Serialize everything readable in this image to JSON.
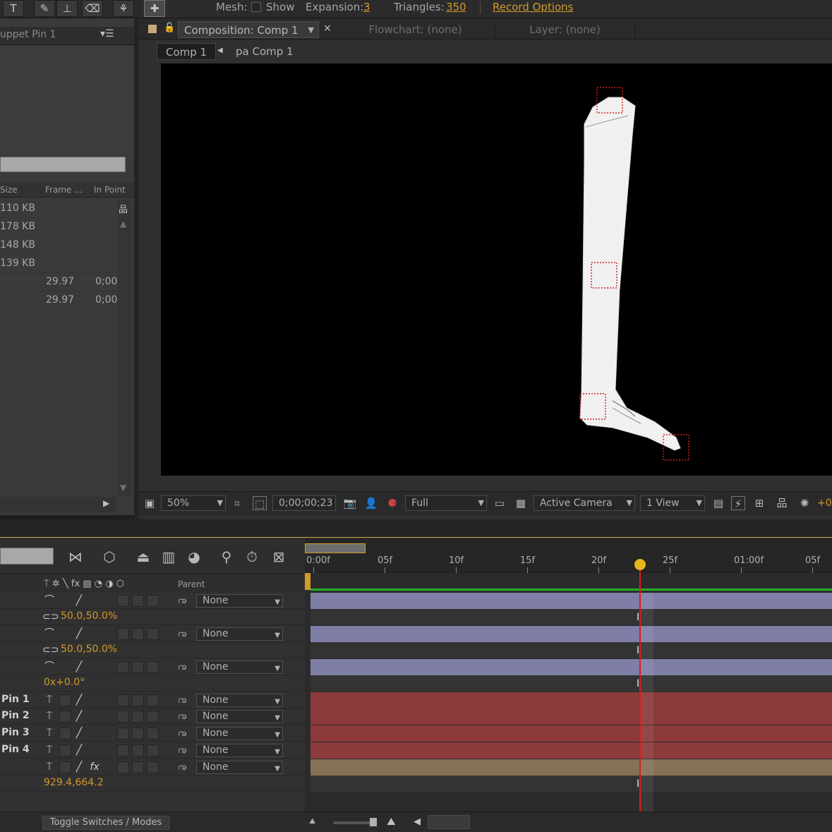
{
  "toolbar": {
    "text_tool": "T",
    "mesh_label": "Mesh:",
    "show_label": "Show",
    "show_checked": false,
    "expansion_label": "Expansion:",
    "expansion_value": "3",
    "triangles_label": "Triangles:",
    "triangles_value": "350",
    "record_options": "Record Options"
  },
  "project_panel": {
    "tab_title": "uppet Pin 1",
    "columns": [
      "Size",
      "Frame ...",
      "In Point"
    ],
    "rows": [
      {
        "size": "110 KB",
        "frame_rate": "",
        "in_point": ""
      },
      {
        "size": "178 KB",
        "frame_rate": "",
        "in_point": ""
      },
      {
        "size": "148 KB",
        "frame_rate": "",
        "in_point": ""
      },
      {
        "size": "139 KB",
        "frame_rate": "",
        "in_point": ""
      },
      {
        "size": "",
        "frame_rate": "29.97",
        "in_point": "0;00"
      },
      {
        "size": "",
        "frame_rate": "29.97",
        "in_point": "0;00"
      }
    ]
  },
  "composition_panel": {
    "tabs": {
      "composition": "Composition: Comp 1",
      "flowchart": "Flowchart: (none)",
      "layer": "Layer: (none)"
    },
    "breadcrumbs": [
      "Comp 1",
      "pa Comp 1"
    ],
    "viewer_bar": {
      "zoom": "50%",
      "timecode": "0;00;00;23",
      "resolution": "Full",
      "camera": "Active Camera",
      "views": "1 View",
      "exposure": "+0"
    }
  },
  "timeline": {
    "columns": {
      "parent": "Parent"
    },
    "ruler_ticks": [
      "0:00f",
      "05f",
      "10f",
      "15f",
      "20f",
      "25f",
      "01:00f",
      "05f"
    ],
    "current_frame": 23,
    "frames_per_ruler_unit": 5,
    "rows": [
      {
        "kind": "layer",
        "name": "",
        "parent": "None",
        "track_color": "#7f7ea6"
      },
      {
        "kind": "property",
        "value": "50.0,50.0%"
      },
      {
        "kind": "layer",
        "name": "",
        "parent": "None",
        "track_color": "#7f7ea6"
      },
      {
        "kind": "property",
        "value": "50.0,50.0%"
      },
      {
        "kind": "layer",
        "name": "",
        "parent": "None",
        "track_color": "#7f7ea6"
      },
      {
        "kind": "property",
        "value": "0x+0.0°"
      },
      {
        "kind": "layer",
        "name": "Pin 1",
        "parent": "None",
        "track_color": "#8c3a3a"
      },
      {
        "kind": "layer",
        "name": "Pin 2",
        "parent": "None",
        "track_color": "#8c3a3a"
      },
      {
        "kind": "layer",
        "name": "Pin 3",
        "parent": "None",
        "track_color": "#8c3a3a"
      },
      {
        "kind": "layer",
        "name": "Pin 4",
        "parent": "None",
        "track_color": "#8c3a3a"
      },
      {
        "kind": "layer",
        "name": "",
        "parent": "None",
        "track_color": "#857156",
        "fx": true
      },
      {
        "kind": "property",
        "value": "929.4,664.2"
      }
    ],
    "toggle_switches_label": "Toggle Switches / Modes"
  },
  "colors": {
    "accent": "#d39a2a",
    "cti": "#d51d1d",
    "green_bar": "#22b022"
  }
}
